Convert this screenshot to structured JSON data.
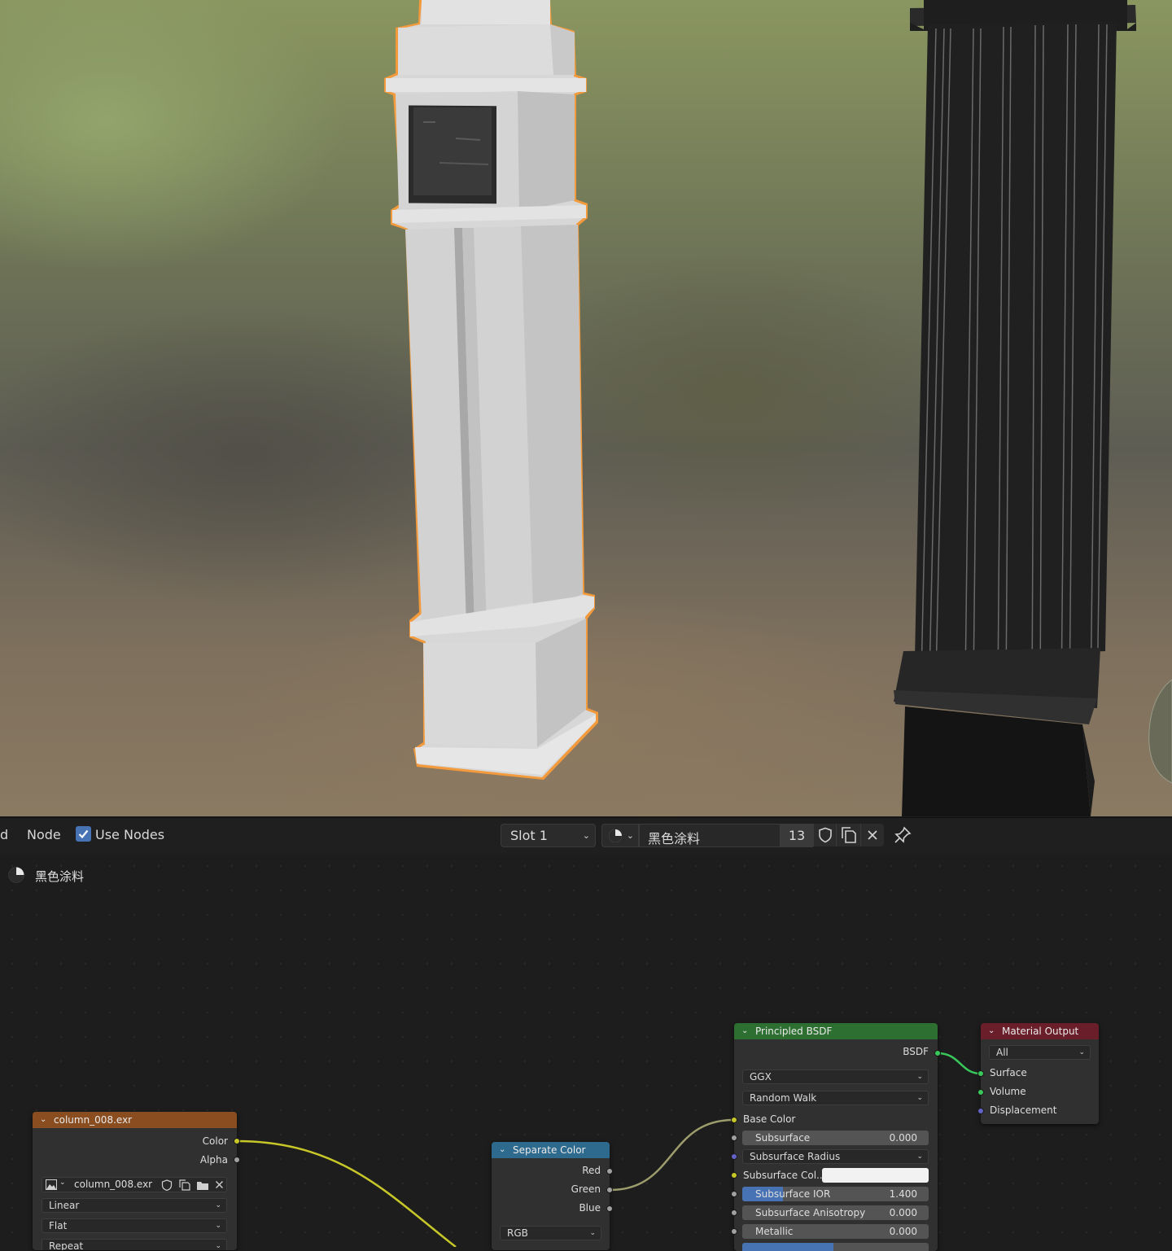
{
  "header": {
    "left_cut_label": "d",
    "node_menu": "Node",
    "use_nodes_label": "Use Nodes",
    "use_nodes_checked": true,
    "slot_label": "Slot 1",
    "material_name": "黑色涂料",
    "user_count": "13"
  },
  "editor": {
    "material_label": "黑色涂料"
  },
  "nodes": {
    "image_texture": {
      "title": "column_008.exr",
      "outputs": [
        "Color",
        "Alpha"
      ],
      "image_name": "column_008.exr",
      "interpolation": "Linear",
      "projection": "Flat",
      "extension": "Repeat"
    },
    "separate_color": {
      "title": "Separate Color",
      "outputs": [
        "Red",
        "Green",
        "Blue"
      ],
      "mode": "RGB"
    },
    "principled_bsdf": {
      "title": "Principled BSDF",
      "output": "BSDF",
      "distribution": "GGX",
      "subsurface_method": "Random Walk",
      "inputs": {
        "base_color": "Base Color",
        "subsurface": {
          "label": "Subsurface",
          "value": "0.000"
        },
        "subsurface_radius": "Subsurface Radius",
        "subsurface_color": "Subsurface Col...",
        "subsurface_ior": {
          "label": "Subsurface IOR",
          "value": "1.400",
          "fill": 0.22
        },
        "subsurface_anisotropy": {
          "label": "Subsurface Anisotropy",
          "value": "0.000"
        },
        "metallic": {
          "label": "Metallic",
          "value": "0.000"
        }
      }
    },
    "material_output": {
      "title": "Material Output",
      "target": "All",
      "inputs": [
        "Surface",
        "Volume",
        "Displacement"
      ]
    }
  },
  "colors": {
    "selection_outline": "#f39a3c",
    "accent_blue": "#4772b3",
    "link_yellow": "#c7c729",
    "link_green": "#39c75a"
  }
}
